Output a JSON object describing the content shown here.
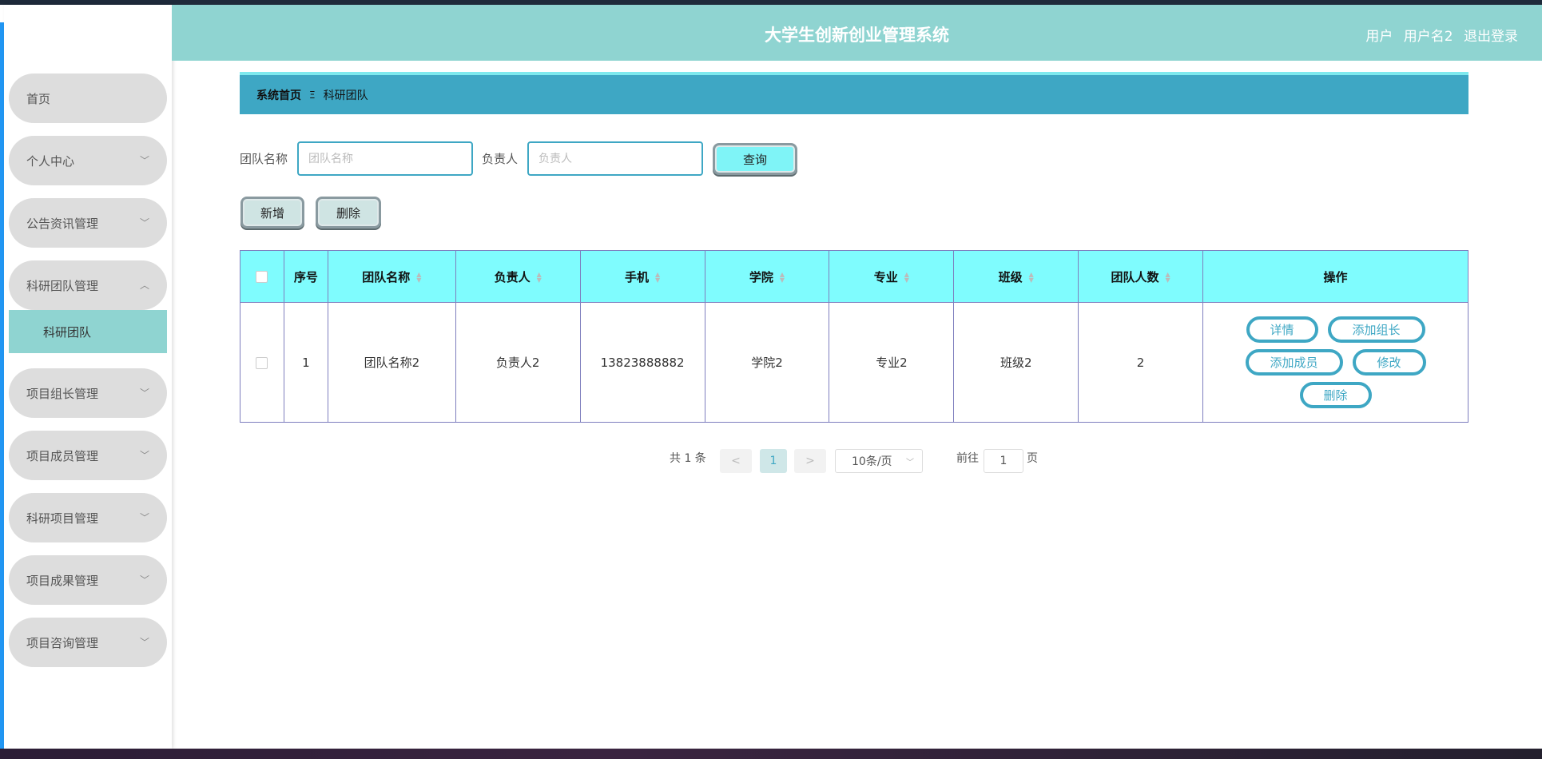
{
  "app": {
    "title": "大学生创新创业管理系统",
    "user_label": "用户",
    "username": "用户名2",
    "logout": "退出登录"
  },
  "sidebar": {
    "items": [
      {
        "label": "首页"
      },
      {
        "label": "个人中心",
        "chevron": "﹀"
      },
      {
        "label": "公告资讯管理",
        "chevron": "﹀"
      },
      {
        "label": "科研团队管理",
        "chevron": "︿"
      },
      {
        "label": "项目组长管理",
        "chevron": "﹀"
      },
      {
        "label": "项目成员管理",
        "chevron": "﹀"
      },
      {
        "label": "科研项目管理",
        "chevron": "﹀"
      },
      {
        "label": "项目成果管理",
        "chevron": "﹀"
      },
      {
        "label": "项目咨询管理",
        "chevron": "﹀"
      }
    ],
    "sub_active": "科研团队"
  },
  "breadcrumb": {
    "home": "系统首页",
    "sep": "Ξ",
    "current": "科研团队"
  },
  "search": {
    "team_label": "团队名称",
    "team_placeholder": "团队名称",
    "leader_label": "负责人",
    "leader_placeholder": "负责人",
    "query_button": "查询"
  },
  "actions": {
    "add": "新增",
    "delete": "删除"
  },
  "table": {
    "columns": [
      "序号",
      "团队名称",
      "负责人",
      "手机",
      "学院",
      "专业",
      "班级",
      "团队人数",
      "操作"
    ],
    "rows": [
      {
        "index": "1",
        "team": "团队名称2",
        "leader": "负责人2",
        "phone": "13823888882",
        "college": "学院2",
        "major": "专业2",
        "class": "班级2",
        "count": "2"
      }
    ],
    "row_actions": [
      "详情",
      "添加组长",
      "添加成员",
      "修改",
      "删除"
    ]
  },
  "pagination": {
    "total": "共 1 条",
    "prev": "<",
    "current": "1",
    "next": ">",
    "page_size": "10条/页",
    "goto_label": "前往",
    "goto_value": "1",
    "page_suffix": "页"
  },
  "colors": {
    "header": "#8fd4d1",
    "breadcrumb": "#3ea7c4",
    "table_header": "#7ffcfe",
    "accent": "#3ea7c4"
  }
}
